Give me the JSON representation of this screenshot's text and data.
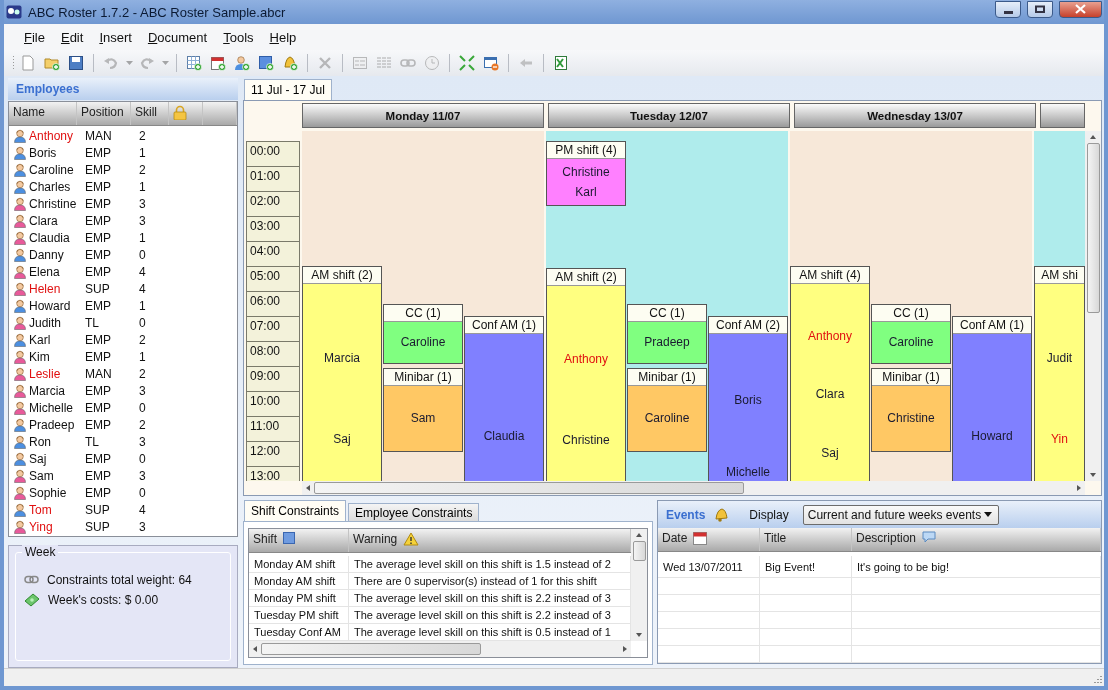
{
  "window": {
    "title": "ABC Roster 1.7.2 - ABC Roster Sample.abcr"
  },
  "menu": [
    "File",
    "Edit",
    "Insert",
    "Document",
    "Tools",
    "Help"
  ],
  "toolbar": [
    [
      {
        "disabled": false
      },
      {
        "disabled": false
      },
      {
        "disabled": false
      }
    ],
    [
      {
        "disabled": true
      },
      {
        "disabled": true
      },
      {
        "disabled": true
      },
      {
        "disabled": true
      }
    ],
    [
      {
        "disabled": false
      },
      {
        "disabled": false
      },
      {
        "disabled": false
      },
      {
        "disabled": false
      },
      {
        "disabled": false
      }
    ],
    [
      {
        "disabled": true
      }
    ],
    [
      {
        "disabled": true
      },
      {
        "disabled": true
      },
      {
        "disabled": true
      },
      {
        "disabled": true
      }
    ],
    [
      {
        "disabled": false
      },
      {
        "disabled": false
      }
    ],
    [
      {
        "disabled": true
      }
    ],
    [
      {
        "disabled": false
      }
    ]
  ],
  "employees": {
    "title": "Employees",
    "columns": [
      "Name",
      "Position",
      "Skill"
    ],
    "rows": [
      {
        "kind": "male",
        "name": "Anthony",
        "position": "MAN",
        "skill": "2",
        "highlighted": true
      },
      {
        "kind": "male",
        "name": "Boris",
        "position": "EMP",
        "skill": "1",
        "highlighted": false
      },
      {
        "kind": "male",
        "name": "Caroline",
        "position": "EMP",
        "skill": "2",
        "highlighted": false
      },
      {
        "kind": "male",
        "name": "Charles",
        "position": "EMP",
        "skill": "1",
        "highlighted": false
      },
      {
        "kind": "female",
        "name": "Christine",
        "position": "EMP",
        "skill": "3",
        "highlighted": false
      },
      {
        "kind": "female",
        "name": "Clara",
        "position": "EMP",
        "skill": "3",
        "highlighted": false
      },
      {
        "kind": "female",
        "name": "Claudia",
        "position": "EMP",
        "skill": "1",
        "highlighted": false
      },
      {
        "kind": "male",
        "name": "Danny",
        "position": "EMP",
        "skill": "0",
        "highlighted": false
      },
      {
        "kind": "female",
        "name": "Elena",
        "position": "EMP",
        "skill": "4",
        "highlighted": false
      },
      {
        "kind": "female",
        "name": "Helen",
        "position": "SUP",
        "skill": "4",
        "highlighted": true
      },
      {
        "kind": "male",
        "name": "Howard",
        "position": "EMP",
        "skill": "1",
        "highlighted": false
      },
      {
        "kind": "female",
        "name": "Judith",
        "position": "TL",
        "skill": "0",
        "highlighted": false
      },
      {
        "kind": "male",
        "name": "Karl",
        "position": "EMP",
        "skill": "2",
        "highlighted": false
      },
      {
        "kind": "female",
        "name": "Kim",
        "position": "EMP",
        "skill": "1",
        "highlighted": false
      },
      {
        "kind": "female",
        "name": "Leslie",
        "position": "MAN",
        "skill": "2",
        "highlighted": true
      },
      {
        "kind": "female",
        "name": "Marcia",
        "position": "EMP",
        "skill": "3",
        "highlighted": false
      },
      {
        "kind": "female",
        "name": "Michelle",
        "position": "EMP",
        "skill": "0",
        "highlighted": false
      },
      {
        "kind": "male",
        "name": "Pradeep",
        "position": "EMP",
        "skill": "2",
        "highlighted": false
      },
      {
        "kind": "male",
        "name": "Ron",
        "position": "TL",
        "skill": "3",
        "highlighted": false
      },
      {
        "kind": "male",
        "name": "Saj",
        "position": "EMP",
        "skill": "0",
        "highlighted": false
      },
      {
        "kind": "female",
        "name": "Sam",
        "position": "EMP",
        "skill": "3",
        "highlighted": false
      },
      {
        "kind": "female",
        "name": "Sophie",
        "position": "EMP",
        "skill": "0",
        "highlighted": false
      },
      {
        "kind": "male",
        "name": "Tom",
        "position": "SUP",
        "skill": "4",
        "highlighted": true
      },
      {
        "kind": "female",
        "name": "Ying",
        "position": "SUP",
        "skill": "3",
        "highlighted": true
      }
    ]
  },
  "week": {
    "title": "Week",
    "constraints": "Constraints total weight: 64",
    "costs": "Week's costs: $ 0.00"
  },
  "calendar": {
    "tabs": [
      {
        "label": "11 Jul - 17 Jul",
        "selected": true
      }
    ],
    "hours": [
      "00:00",
      "01:00",
      "02:00",
      "03:00",
      "04:00",
      "05:00",
      "06:00",
      "07:00",
      "08:00",
      "09:00",
      "10:00",
      "11:00",
      "12:00",
      "13:00"
    ],
    "days": [
      {
        "title": "Monday 11/07",
        "color": "#f7e8d9",
        "shifts": [
          {
            "title": "AM shift (2)",
            "color": "#ffff80",
            "staff": [
              {
                "name": "Marcia",
                "highlighted": false
              },
              {
                "name": "Saj",
                "highlighted": false
              }
            ]
          },
          {
            "title": "CC (1)",
            "color": "#80ff80",
            "staff": [
              {
                "name": "Caroline",
                "highlighted": false
              }
            ]
          },
          {
            "title": "Minibar (1)",
            "color": "#ffc864",
            "staff": [
              {
                "name": "Sam",
                "highlighted": false
              }
            ]
          },
          {
            "title": "Conf AM (1)",
            "color": "#8080ff",
            "staff": [
              {
                "name": "Claudia",
                "highlighted": false
              }
            ]
          }
        ]
      },
      {
        "title": "Tuesday 12/07",
        "color": "#afecec",
        "shifts": [
          {
            "title": "PM shift (4)",
            "color": "#ff80ff",
            "staff": [
              {
                "name": "Christine",
                "highlighted": false
              },
              {
                "name": "Karl",
                "highlighted": false
              }
            ]
          },
          {
            "title": "AM shift (2)",
            "color": "#ffff80",
            "staff": [
              {
                "name": "Anthony",
                "highlighted": true
              },
              {
                "name": "Christine",
                "highlighted": false
              }
            ]
          },
          {
            "title": "CC (1)",
            "color": "#80ff80",
            "staff": [
              {
                "name": "Pradeep",
                "highlighted": false
              }
            ]
          },
          {
            "title": "Minibar (1)",
            "color": "#ffc864",
            "staff": [
              {
                "name": "Caroline",
                "highlighted": false
              }
            ]
          },
          {
            "title": "Conf AM (2)",
            "color": "#8080ff",
            "staff": [
              {
                "name": "Boris",
                "highlighted": false
              },
              {
                "name": "Michelle",
                "highlighted": false
              }
            ]
          }
        ]
      },
      {
        "title": "Wednesday 13/07",
        "color": "#f7e8d9",
        "shifts": [
          {
            "title": "AM shift (4)",
            "color": "#ffff80",
            "staff": [
              {
                "name": "Anthony",
                "highlighted": true
              },
              {
                "name": "Clara",
                "highlighted": false
              },
              {
                "name": "Saj",
                "highlighted": false
              }
            ]
          },
          {
            "title": "CC (1)",
            "color": "#80ff80",
            "staff": [
              {
                "name": "Caroline",
                "highlighted": false
              }
            ]
          },
          {
            "title": "Minibar (1)",
            "color": "#ffc864",
            "staff": [
              {
                "name": "Christine",
                "highlighted": false
              }
            ]
          },
          {
            "title": "Conf AM (1)",
            "color": "#8080ff",
            "staff": [
              {
                "name": "Howard",
                "highlighted": false
              }
            ]
          }
        ]
      },
      {
        "color": "#afecec",
        "shifts": [
          {
            "title": "AM shi",
            "color": "#ffff80",
            "staff": [
              {
                "name": "Judit",
                "highlighted": false
              },
              {
                "name": "Yin",
                "highlighted": true
              }
            ]
          }
        ]
      }
    ]
  },
  "constraints": {
    "tabs": [
      {
        "label": "Shift Constraints",
        "selected": true
      },
      {
        "label": "Employee Constraints",
        "selected": false
      }
    ],
    "columns": [
      "Shift",
      "Warning"
    ],
    "rows": [
      {
        "shift": "Monday AM shift",
        "warning": "The average level skill on this shift is 1.5 instead of 2"
      },
      {
        "shift": "Monday AM shift",
        "warning": "There are 0 supervisor(s) instead of 1 for this shift"
      },
      {
        "shift": "Monday PM shift",
        "warning": "The average level skill on this shift is 2.2 instead of 3"
      },
      {
        "shift": "Tuesday PM shift",
        "warning": "The average level skill on this shift is 2.2 instead of 3"
      },
      {
        "shift": "Tuesday Conf AM",
        "warning": "The average level skill on this shift is 0.5 instead of 1"
      }
    ]
  },
  "events": {
    "title": "Events",
    "display_label": "Display",
    "display_value": "Current and future weeks events",
    "columns": [
      "Date",
      "Title",
      "Description"
    ],
    "rows": [
      {
        "date": "Wed 13/07/2011",
        "title": "Big Event!",
        "description": "It's going to be big!"
      }
    ]
  }
}
